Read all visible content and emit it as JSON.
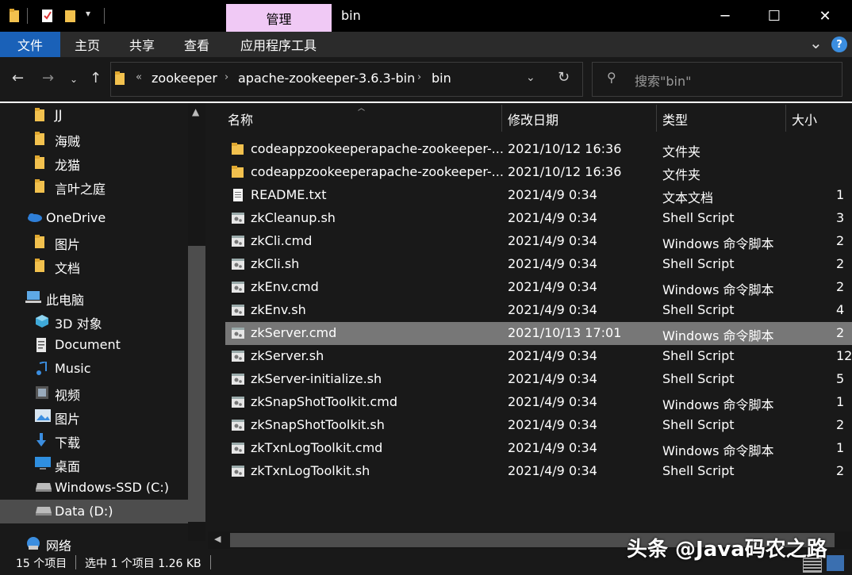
{
  "window": {
    "title": "bin",
    "context_tab": "管理",
    "minimize": "─",
    "maximize": "☐",
    "close": "✕"
  },
  "ribbon": {
    "tabs": [
      "文件",
      "主页",
      "共享",
      "查看",
      "应用程序工具"
    ],
    "help": "?",
    "collapse": "⌄"
  },
  "address": {
    "overflow": "«",
    "crumbs": [
      "zookeeper",
      "apache-zookeeper-3.6.3-bin",
      "bin"
    ],
    "search_placeholder": "搜索\"bin\""
  },
  "sidebar": {
    "items": [
      {
        "label": "JJ",
        "icon": "folder-icon"
      },
      {
        "label": "海贼",
        "icon": "folder-icon"
      },
      {
        "label": "龙猫",
        "icon": "folder-icon"
      },
      {
        "label": "言叶之庭",
        "icon": "folder-icon"
      },
      {
        "label": "OneDrive",
        "icon": "cloud-icon"
      },
      {
        "label": "图片",
        "icon": "folder-icon"
      },
      {
        "label": "文档",
        "icon": "folder-icon"
      },
      {
        "label": "此电脑",
        "icon": "computer-icon"
      },
      {
        "label": "3D 对象",
        "icon": "cube-icon"
      },
      {
        "label": "Document",
        "icon": "document-icon"
      },
      {
        "label": "Music",
        "icon": "music-icon"
      },
      {
        "label": "视频",
        "icon": "video-icon"
      },
      {
        "label": "图片",
        "icon": "picture-icon"
      },
      {
        "label": "下载",
        "icon": "download-icon"
      },
      {
        "label": "桌面",
        "icon": "desktop-icon"
      },
      {
        "label": "Windows-SSD (C:)",
        "icon": "drive-icon"
      },
      {
        "label": "Data (D:)",
        "icon": "drive-icon"
      },
      {
        "label": "网络",
        "icon": "network-icon"
      }
    ]
  },
  "list": {
    "columns": [
      "名称",
      "修改日期",
      "类型",
      "大小"
    ],
    "rows": [
      {
        "name": "codeappzookeeperapache-zookeeper-...",
        "date": "2021/10/12 16:36",
        "type": "文件夹",
        "size": "",
        "icon": "folder-icon"
      },
      {
        "name": "codeappzookeeperapache-zookeeper-...",
        "date": "2021/10/12 16:36",
        "type": "文件夹",
        "size": "",
        "icon": "folder-icon"
      },
      {
        "name": "README.txt",
        "date": "2021/4/9 0:34",
        "type": "文本文档",
        "size": "1",
        "icon": "text-file-icon"
      },
      {
        "name": "zkCleanup.sh",
        "date": "2021/4/9 0:34",
        "type": "Shell Script",
        "size": "3",
        "icon": "script-file-icon"
      },
      {
        "name": "zkCli.cmd",
        "date": "2021/4/9 0:34",
        "type": "Windows 命令脚本",
        "size": "2",
        "icon": "script-file-icon"
      },
      {
        "name": "zkCli.sh",
        "date": "2021/4/9 0:34",
        "type": "Shell Script",
        "size": "2",
        "icon": "script-file-icon"
      },
      {
        "name": "zkEnv.cmd",
        "date": "2021/4/9 0:34",
        "type": "Windows 命令脚本",
        "size": "2",
        "icon": "script-file-icon"
      },
      {
        "name": "zkEnv.sh",
        "date": "2021/4/9 0:34",
        "type": "Shell Script",
        "size": "4",
        "icon": "script-file-icon"
      },
      {
        "name": "zkServer.cmd",
        "date": "2021/10/13 17:01",
        "type": "Windows 命令脚本",
        "size": "2",
        "icon": "script-file-icon"
      },
      {
        "name": "zkServer.sh",
        "date": "2021/4/9 0:34",
        "type": "Shell Script",
        "size": "12",
        "icon": "script-file-icon"
      },
      {
        "name": "zkServer-initialize.sh",
        "date": "2021/4/9 0:34",
        "type": "Shell Script",
        "size": "5",
        "icon": "script-file-icon"
      },
      {
        "name": "zkSnapShotToolkit.cmd",
        "date": "2021/4/9 0:34",
        "type": "Windows 命令脚本",
        "size": "1",
        "icon": "script-file-icon"
      },
      {
        "name": "zkSnapShotToolkit.sh",
        "date": "2021/4/9 0:34",
        "type": "Shell Script",
        "size": "2",
        "icon": "script-file-icon"
      },
      {
        "name": "zkTxnLogToolkit.cmd",
        "date": "2021/4/9 0:34",
        "type": "Windows 命令脚本",
        "size": "1",
        "icon": "script-file-icon"
      },
      {
        "name": "zkTxnLogToolkit.sh",
        "date": "2021/4/9 0:34",
        "type": "Shell Script",
        "size": "2",
        "icon": "script-file-icon"
      }
    ]
  },
  "status": {
    "count": "15 个项目",
    "selection": "选中 1 个项目  1.26 KB"
  },
  "watermark": "头条 @Java码农之路",
  "colors": {
    "file_tab": "#1a61b8",
    "context_tab": "#f0c9f5",
    "selection": "#777777",
    "folder": "#f2c14e"
  }
}
